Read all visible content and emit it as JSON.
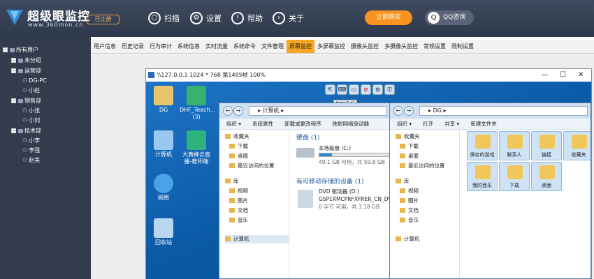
{
  "app": {
    "title": "超级眼监控",
    "url": "www.360mon.cn",
    "registered_badge": "已注册"
  },
  "nav": [
    {
      "label": "扫描",
      "icon": "scan-icon"
    },
    {
      "label": "设置",
      "icon": "gear-icon"
    },
    {
      "label": "帮助",
      "icon": "help-icon"
    },
    {
      "label": "关于",
      "icon": "about-icon"
    }
  ],
  "buy_button": "立即购买",
  "qq_button": "QQ咨询",
  "sidebar": {
    "root": "所有用户",
    "groups": [
      {
        "label": "未分组",
        "users": []
      },
      {
        "label": "运营部",
        "users": [
          "DG-PC",
          "小赵"
        ]
      },
      {
        "label": "销售部",
        "users": [
          "小张",
          "小刘"
        ]
      },
      {
        "label": "技术部",
        "users": [
          "小李",
          "李强",
          "赵美"
        ]
      }
    ]
  },
  "tabs": [
    "用户信息",
    "历史记录",
    "行为审计",
    "系统信息",
    "实时流量",
    "系统命令",
    "文件管理",
    "屏幕监控",
    "多屏幕监控",
    "摄像头监控",
    "多摄像头监控",
    "常规设置",
    "限制设置"
  ],
  "active_tab": "屏幕监控",
  "remote_window": {
    "title": "\\\\127.0.0.1 1024 * 768 第1495帧 100%",
    "tooltip": "控制目标"
  },
  "desktop_icons": [
    "DG",
    "DHF_Teach... (3)",
    "计算机",
    "大黄蜂云直播-教师端",
    "网络",
    "回收站"
  ],
  "explorer1": {
    "path": "计算机",
    "commands": [
      "组织 ▾",
      "系统属性",
      "卸载或更改程序",
      "映射网络驱动器"
    ],
    "nav": [
      "收藏夹",
      "下载",
      "桌面",
      "最近访问的位置",
      "库",
      "视频",
      "图片",
      "文档",
      "音乐",
      "计算机"
    ],
    "section_hdd": "硬盘 (1)",
    "drive_c": {
      "name": "本地磁盘 (C:)",
      "free": "49.1 GB 可用，共 59.8 GB",
      "used_fraction": 0.18
    },
    "section_removable": "有可移动存储的设备 (1)",
    "dvd": {
      "name": "DVD 驱动器 (D:)",
      "label": "GSP1RMCPRFXFRER_CN_DVD",
      "free": "0 字节 可用，共 3.18 GB"
    }
  },
  "explorer2": {
    "path": "DG",
    "commands": [
      "组织 ▾",
      "打开",
      "共享 ▾",
      "新建文件夹"
    ],
    "nav": [
      "收藏夹",
      "下载",
      "桌面",
      "最近访问的位置",
      "库",
      "视频",
      "图片",
      "文档",
      "音乐",
      "计算机"
    ],
    "folders": [
      "保存的游戏",
      "联系人",
      "链接",
      "收藏夹",
      "我的音乐",
      "下载",
      "桌面"
    ]
  }
}
